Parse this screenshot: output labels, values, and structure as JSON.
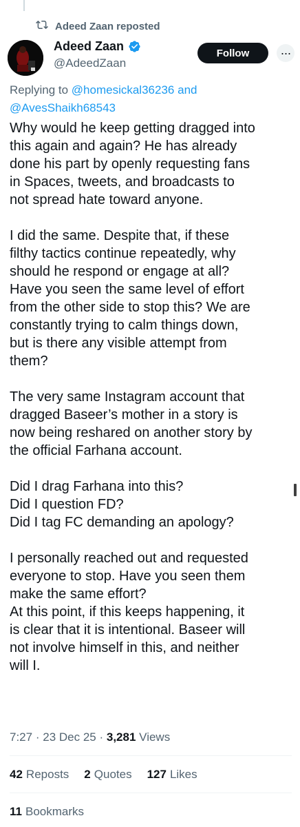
{
  "repost": {
    "text": "Adeed Zaan reposted"
  },
  "author": {
    "name": "Adeed Zaan",
    "handle": "@AdeedZaan"
  },
  "follow_label": "Follow",
  "reply": {
    "prefix": "Replying to",
    "user1": "@homesickal36236",
    "conj": "and",
    "user2": "@AvesShaikh68543"
  },
  "tweet": {
    "lines": [
      "Why would he keep getting dragged into",
      "this again and again? He has already",
      "done his part by openly requesting fans",
      "in Spaces, tweets, and broadcasts to",
      "not spread hate toward anyone.",
      "",
      "I did the same. Despite that, if these",
      "filthy tactics continue repeatedly, why",
      "should he respond or engage at all?",
      "Have you seen the same level of effort",
      "from the other side to stop this? We are",
      "constantly trying to calm things down,",
      "but is there any visible attempt from",
      "them?",
      "",
      "The very same Instagram account that",
      "dragged Baseer’s mother in a story is",
      "now being reshared on another story by",
      "the official Farhana account.",
      "",
      "Did I drag Farhana into this?",
      "Did I question FD?",
      "Did I tag FC demanding an apology?",
      "",
      "I personally reached out and requested",
      "everyone to stop. Have you seen them",
      "make the same effort?",
      "At this point, if this keeps happening, it",
      "is clear that it is intentional. Baseer will",
      "not involve himself in this, and neither",
      "will I."
    ]
  },
  "meta": {
    "time": "7:27",
    "sep": "·",
    "date": "23 Dec 25",
    "views_count": "3,281",
    "views_label": "Views"
  },
  "stats": {
    "reposts_count": "42",
    "reposts_label": "Reposts",
    "quotes_count": "2",
    "quotes_label": "Quotes",
    "likes_count": "127",
    "likes_label": "Likes"
  },
  "bookmarks": {
    "count": "11",
    "label": "Bookmarks"
  },
  "colors": {
    "accent": "#1d9bf0",
    "text": "#0f1419",
    "muted": "#536471",
    "divider": "#eff3f4"
  }
}
